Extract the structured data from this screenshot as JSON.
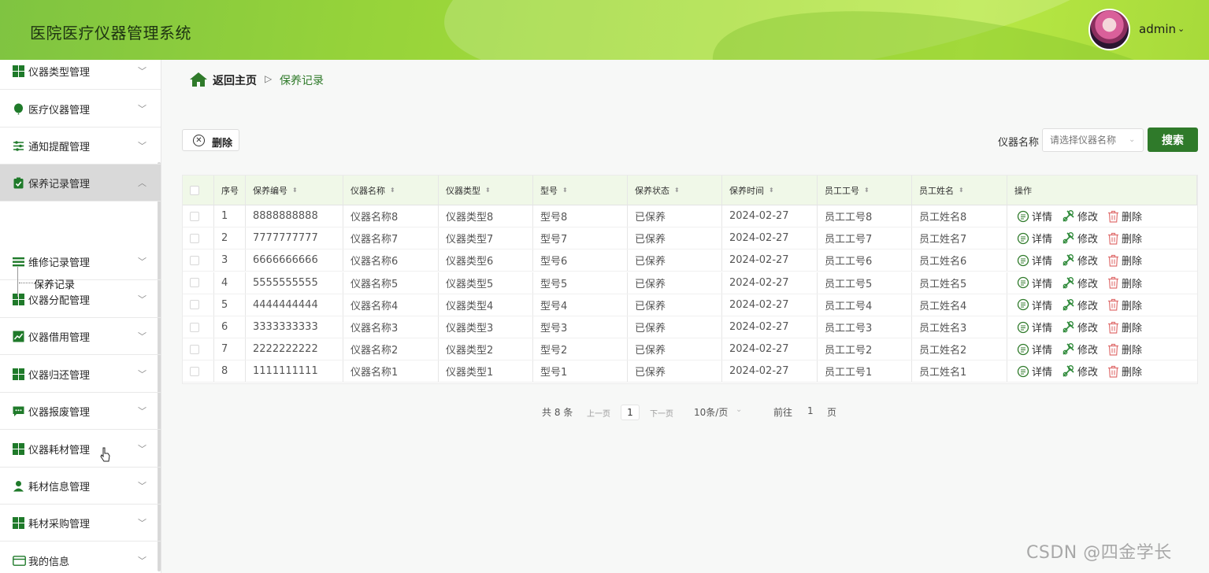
{
  "app": {
    "title": "医院医疗仪器管理系统",
    "user": "admin"
  },
  "sidebar": {
    "items": [
      {
        "label": "仪器类型管理",
        "icon": "grid-icon"
      },
      {
        "label": "医疗仪器管理",
        "icon": "balloon-icon"
      },
      {
        "label": "通知提醒管理",
        "icon": "sliders-icon"
      },
      {
        "label": "保养记录管理",
        "icon": "clipboard-check-icon",
        "active": true
      },
      {
        "label": "维修记录管理",
        "icon": "list-icon"
      },
      {
        "label": "仪器分配管理",
        "icon": "grid-icon"
      },
      {
        "label": "仪器借用管理",
        "icon": "chart-icon"
      },
      {
        "label": "仪器归还管理",
        "icon": "grid-icon"
      },
      {
        "label": "仪器报废管理",
        "icon": "chat-icon"
      },
      {
        "label": "仪器耗材管理",
        "icon": "grid-icon"
      },
      {
        "label": "耗材信息管理",
        "icon": "person-icon"
      },
      {
        "label": "耗材采购管理",
        "icon": "grid-icon"
      },
      {
        "label": "我的信息",
        "icon": "card-icon"
      }
    ],
    "sub_item": "保养记录"
  },
  "breadcrumb": {
    "home": "返回主页",
    "current": "保养记录"
  },
  "toolbar": {
    "delete": "删除",
    "search_label": "仪器名称",
    "search_placeholder": "请选择仪器名称",
    "search_button": "搜索"
  },
  "table": {
    "headers": [
      "序号",
      "保养编号",
      "仪器名称",
      "仪器类型",
      "型号",
      "保养状态",
      "保养时间",
      "员工工号",
      "员工姓名",
      "操作"
    ],
    "actions": {
      "detail": "详情",
      "edit": "修改",
      "delete": "删除"
    },
    "rows": [
      [
        "1",
        "8888888888",
        "仪器名称8",
        "仪器类型8",
        "型号8",
        "已保养",
        "2024-02-27",
        "员工工号8",
        "员工姓名8"
      ],
      [
        "2",
        "7777777777",
        "仪器名称7",
        "仪器类型7",
        "型号7",
        "已保养",
        "2024-02-27",
        "员工工号7",
        "员工姓名7"
      ],
      [
        "3",
        "6666666666",
        "仪器名称6",
        "仪器类型6",
        "型号6",
        "已保养",
        "2024-02-27",
        "员工工号6",
        "员工姓名6"
      ],
      [
        "4",
        "5555555555",
        "仪器名称5",
        "仪器类型5",
        "型号5",
        "已保养",
        "2024-02-27",
        "员工工号5",
        "员工姓名5"
      ],
      [
        "5",
        "4444444444",
        "仪器名称4",
        "仪器类型4",
        "型号4",
        "已保养",
        "2024-02-27",
        "员工工号4",
        "员工姓名4"
      ],
      [
        "6",
        "3333333333",
        "仪器名称3",
        "仪器类型3",
        "型号3",
        "已保养",
        "2024-02-27",
        "员工工号3",
        "员工姓名3"
      ],
      [
        "7",
        "2222222222",
        "仪器名称2",
        "仪器类型2",
        "型号2",
        "已保养",
        "2024-02-27",
        "员工工号2",
        "员工姓名2"
      ],
      [
        "8",
        "1111111111",
        "仪器名称1",
        "仪器类型1",
        "型号1",
        "已保养",
        "2024-02-27",
        "员工工号1",
        "员工姓名1"
      ]
    ]
  },
  "pagination": {
    "total": "共 8 条",
    "prev": "上一页",
    "page": "1",
    "next": "下一页",
    "page_size": "10条/页",
    "goto_label": "前往",
    "goto_value": "1",
    "goto_suffix": "页"
  },
  "watermark": "CSDN @四金学长",
  "colors": {
    "primary": "#2f7a2a",
    "header": "#a4d93c"
  }
}
